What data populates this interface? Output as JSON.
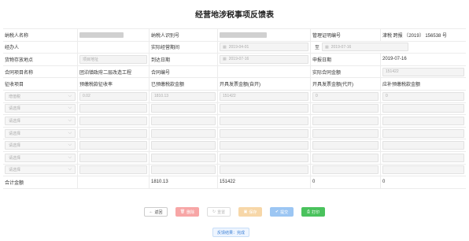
{
  "title": "经营地涉税事项反馈表",
  "labels": {
    "taxpayer_name": "纳税人名称",
    "taxpayer_id": "纳税人识别号",
    "cert_no": "管理证明编号",
    "agent": "经办人",
    "period": "实际经营期间",
    "to": "至",
    "storage": "货物存放地点",
    "arrival": "到达日期",
    "declare_date": "申报日期",
    "contract_name": "合同项目名称",
    "contract_no": "合同编号",
    "contract_amount": "实际合同金额",
    "col_item": "征收项目",
    "col_rate": "预缴税款征收率",
    "col_prepaid": "已预缴税款金额",
    "col_self": "开具发票金额(自开)",
    "col_agent": "开具发票金额(代开)",
    "col_supp": "应补预缴税款金额",
    "total": "合计金额"
  },
  "values": {
    "cert_no": "津税 跨报 〔2019〕 156538 号",
    "period_start": "2019-04-01",
    "period_end": "2019-07-16",
    "storage": "项目地址",
    "arrival": "2019-07-16",
    "declare_date": "2019-07-16",
    "contract_name": "团泊镇政府二层改造工程",
    "contract_amount": "151422"
  },
  "rows": [
    {
      "item": "增值税",
      "rate": "0.02",
      "prepaid": "1810.13",
      "self": "151422",
      "agent": "0",
      "supp": "0"
    },
    {
      "item": "请选择",
      "rate": "",
      "prepaid": "",
      "self": "",
      "agent": "",
      "supp": ""
    },
    {
      "item": "请选择",
      "rate": "",
      "prepaid": "",
      "self": "",
      "agent": "",
      "supp": ""
    },
    {
      "item": "请选择",
      "rate": "",
      "prepaid": "",
      "self": "",
      "agent": "",
      "supp": ""
    },
    {
      "item": "请选择",
      "rate": "",
      "prepaid": "",
      "self": "",
      "agent": "",
      "supp": ""
    },
    {
      "item": "请选择",
      "rate": "",
      "prepaid": "",
      "self": "",
      "agent": "",
      "supp": ""
    },
    {
      "item": "请选择",
      "rate": "",
      "prepaid": "",
      "self": "",
      "agent": "",
      "supp": ""
    }
  ],
  "totals": {
    "prepaid": "1810.13",
    "self": "151422",
    "agent": "0",
    "supp": "0"
  },
  "buttons": {
    "back": "返回",
    "del": "删除",
    "reset": "重置",
    "save": "保存",
    "submit": "提交",
    "print": "打印"
  },
  "result": "反馈结果：完成",
  "icons": {
    "back": "arrow-left-icon",
    "del": "trash-icon",
    "reset": "reset-icon",
    "save": "save-icon",
    "submit": "check-circle-icon",
    "print": "print-icon",
    "calendar": "calendar-icon",
    "dropdown": "chevron-down-icon"
  }
}
